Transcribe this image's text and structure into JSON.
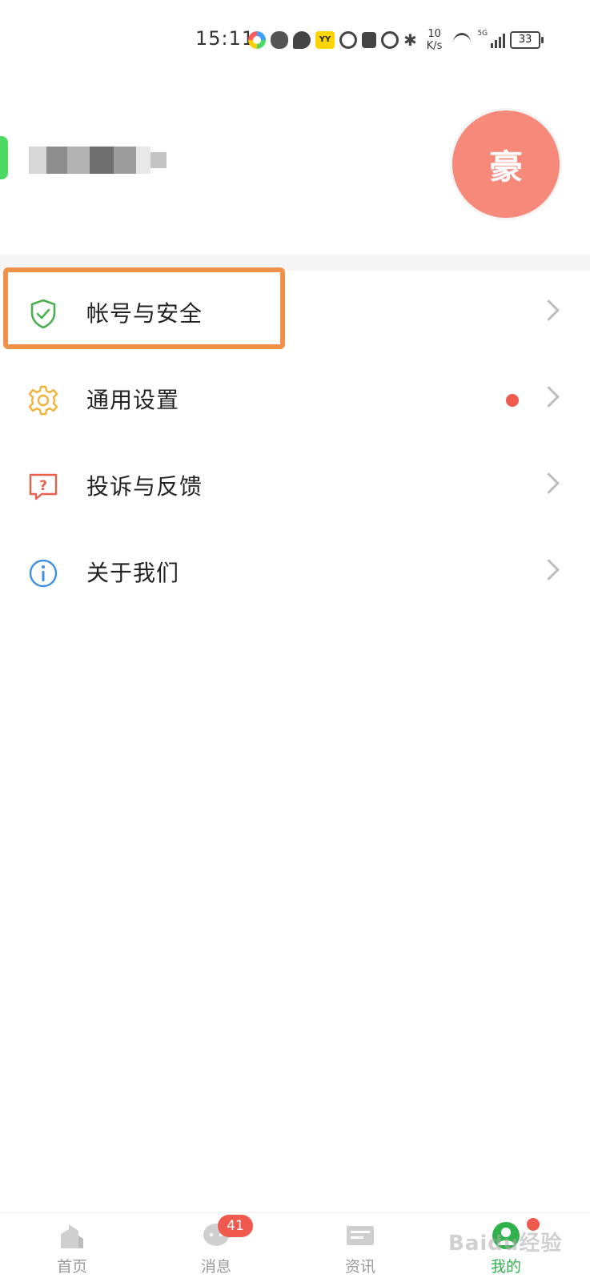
{
  "status_bar": {
    "time": "15:11",
    "net_speed_value": "10",
    "net_speed_unit": "K/s",
    "network_type": "5G",
    "battery": "33"
  },
  "profile": {
    "avatar_text": "豪"
  },
  "menu": {
    "items": [
      {
        "label": "帐号与安全",
        "icon": "shield-check-icon",
        "color": "#4caf50"
      },
      {
        "label": "通用设置",
        "icon": "gear-icon",
        "color": "#f2b33d",
        "has_dot": true
      },
      {
        "label": "投诉与反馈",
        "icon": "question-bubble-icon",
        "color": "#e8604c"
      },
      {
        "label": "关于我们",
        "icon": "info-icon",
        "color": "#3d8fe0"
      }
    ],
    "highlight_color": "#f0914a"
  },
  "bottom_nav": {
    "items": [
      {
        "label": "首页",
        "icon": "home-icon"
      },
      {
        "label": "消息",
        "icon": "chat-icon",
        "badge": "41"
      },
      {
        "label": "资讯",
        "icon": "news-icon"
      },
      {
        "label": "我的",
        "icon": "profile-icon",
        "active": true
      }
    ],
    "active_color": "#2fb24c"
  },
  "watermark": "Baidu经验"
}
